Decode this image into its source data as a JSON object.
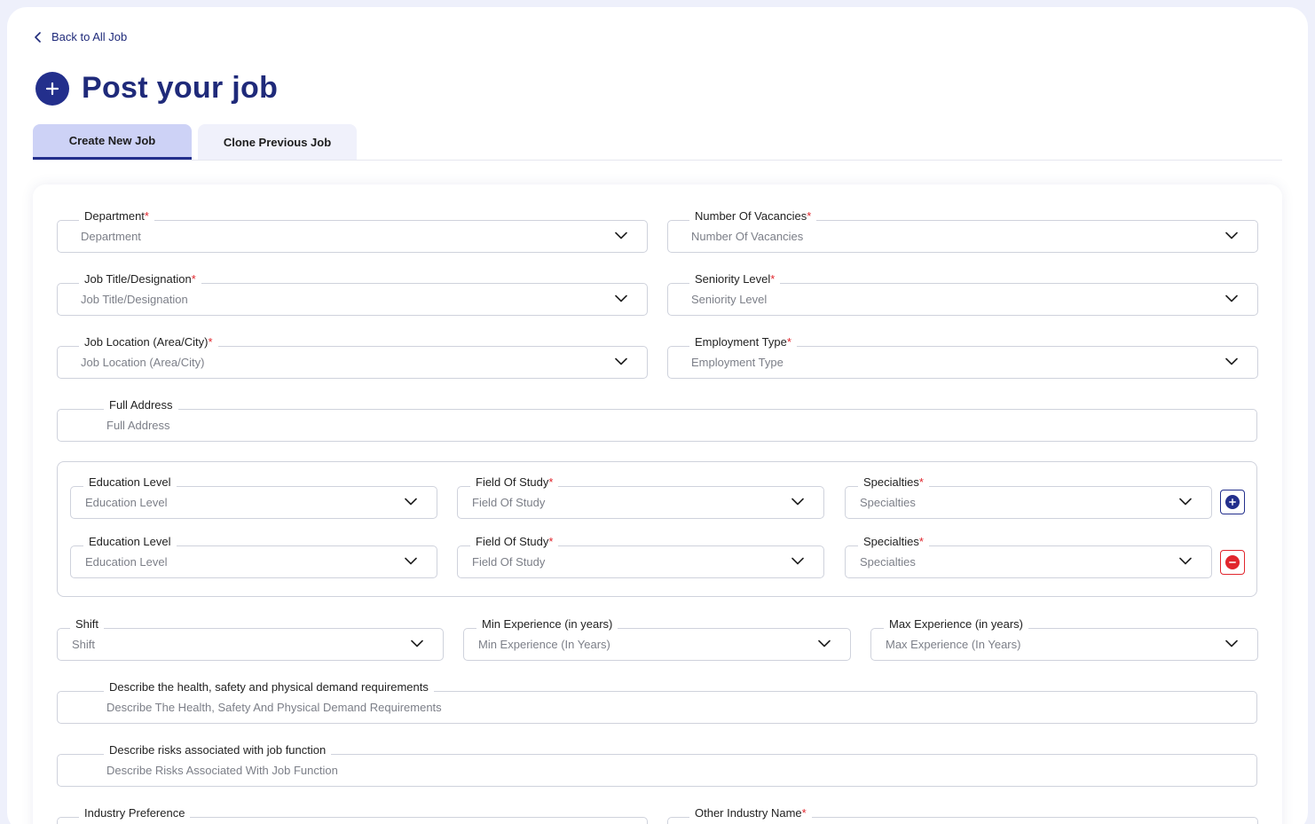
{
  "nav": {
    "back_label": "Back to All Job"
  },
  "page": {
    "title": "Post your job"
  },
  "tabs": [
    {
      "label": "Create New Job"
    },
    {
      "label": "Clone Previous Job"
    }
  ],
  "form": {
    "department": {
      "label": "Department",
      "placeholder": "Department"
    },
    "vacancies": {
      "label": "Number Of Vacancies",
      "placeholder": "Number Of Vacancies"
    },
    "job_title": {
      "label": "Job Title/Designation",
      "placeholder": "Job Title/Designation"
    },
    "seniority": {
      "label": "Seniority Level",
      "placeholder": "Seniority Level"
    },
    "location": {
      "label": "Job Location (Area/City)",
      "placeholder": "Job Location (Area/City)"
    },
    "employment_type": {
      "label": "Employment Type",
      "placeholder": "Employment Type"
    },
    "full_address": {
      "label": "Full Address",
      "placeholder": "Full Address"
    },
    "education_rows": [
      {
        "education_level": {
          "label": "Education Level",
          "placeholder": "Education Level"
        },
        "field_of_study": {
          "label": "Field Of Study",
          "placeholder": "Field Of Study"
        },
        "specialties": {
          "label": "Specialties",
          "placeholder": "Specialties"
        }
      },
      {
        "education_level": {
          "label": "Education Level",
          "placeholder": "Education Level"
        },
        "field_of_study": {
          "label": "Field Of Study",
          "placeholder": "Field Of Study"
        },
        "specialties": {
          "label": "Specialties",
          "placeholder": "Specialties"
        }
      }
    ],
    "shift": {
      "label": "Shift",
      "placeholder": "Shift"
    },
    "min_exp": {
      "label": "Min Experience (in years)",
      "placeholder": "Min Experience (In Years)"
    },
    "max_exp": {
      "label": "Max Experience (in years)",
      "placeholder": "Max Experience (In Years)"
    },
    "health_safety": {
      "label": "Describe the health, safety and physical demand requirements",
      "placeholder": "Describe The Health, Safety And Physical Demand Requirements"
    },
    "risks": {
      "label": "Describe risks associated with job function",
      "placeholder": "Describe Risks Associated With Job Function"
    },
    "industry_pref": {
      "label": "Industry Preference"
    },
    "other_industry": {
      "label": "Other Industry Name"
    }
  },
  "required_marker": "*",
  "colors": {
    "primary": "#232f8c",
    "danger": "#e1262d",
    "tab_active_bg": "#cdd2f6"
  }
}
